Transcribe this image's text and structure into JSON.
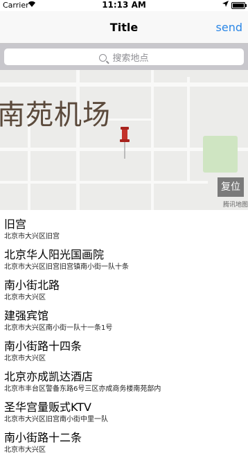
{
  "status_bar": {
    "carrier": "Carrier",
    "time": "11:13 AM",
    "icons": [
      "wifi-icon",
      "location-arrow-icon",
      "battery-icon"
    ]
  },
  "nav": {
    "title": "Title",
    "send_label": "send"
  },
  "search": {
    "placeholder": "搜索地点"
  },
  "map": {
    "place_label": "南苑机场",
    "reset_label": "复位",
    "brand_label": "腾讯地图"
  },
  "results": [
    {
      "name": "旧宫",
      "address": "北京市大兴区旧宫"
    },
    {
      "name": "北京华人阳光国画院",
      "address": "北京市大兴区旧宫旧宫镇南小街一队十条"
    },
    {
      "name": "南小街北路",
      "address": "北京市大兴区"
    },
    {
      "name": "建强宾馆",
      "address": "北京市大兴区南小街一队十一条1号"
    },
    {
      "name": "南小街路十四条",
      "address": "北京市大兴区"
    },
    {
      "name": "北京亦成凯达酒店",
      "address": "北京市丰台区警备东路6号三区亦成商务楼南苑部内"
    },
    {
      "name": "圣华宫量贩式KTV",
      "address": "北京市大兴区旧宫南小街中里一队"
    },
    {
      "name": "南小街路十二条",
      "address": "北京市大兴区"
    }
  ],
  "colors": {
    "accent": "#2a86e6",
    "nav_bg": "#f8f8f8",
    "search_bar_bg": "#c8c7cc",
    "reset_bg": "#7a7a7a",
    "park_green": "#cfe5c2"
  }
}
